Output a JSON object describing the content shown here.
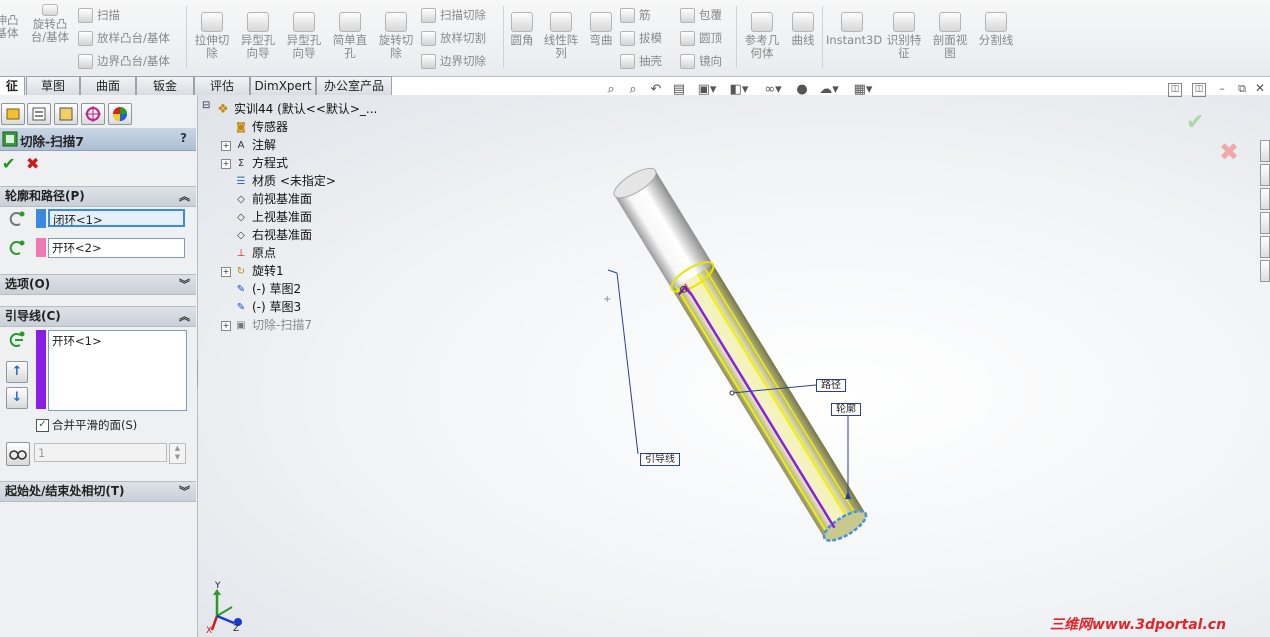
{
  "ribbon": {
    "features": [
      {
        "label_l1": "伸凸",
        "label_l2": "基体"
      },
      {
        "label_l1": "旋转凸",
        "label_l2": "台/基体"
      }
    ],
    "sweep_boss": "扫描",
    "loft_boss": "放样凸台/基体",
    "boundary_boss": "边界凸台/基体",
    "cut_extrude": {
      "l1": "拉伸切",
      "l2": "除"
    },
    "hole_wizard": {
      "l1": "异型孔",
      "l2": "向导"
    },
    "hole_wizard2": {
      "l1": "异型孔",
      "l2": "向导"
    },
    "simple_hole": {
      "l1": "简单直",
      "l2": "孔"
    },
    "revolve_cut": {
      "l1": "旋转切",
      "l2": "除"
    },
    "sweep_cut": "扫描切除",
    "loft_cut": "放样切割",
    "boundary_cut": "边界切除",
    "fillet": "圆角",
    "linear_pattern": {
      "l1": "线性阵",
      "l2": "列"
    },
    "flex": "弯曲",
    "rib": "筋",
    "draft": "拔模",
    "shell": "抽壳",
    "wrap": "包覆",
    "dome": "圆顶",
    "mirror": "镜向",
    "ref_geometry": {
      "l1": "参考几",
      "l2": "何体"
    },
    "curves": "曲线",
    "instant3d": "Instant3D",
    "recognize": {
      "l1": "识别特",
      "l2": "征"
    },
    "section_view": {
      "l1": "剖面视",
      "l2": "图"
    },
    "split_line": "分割线"
  },
  "tabs": [
    "征",
    "草图",
    "曲面",
    "钣金",
    "评估",
    "DimXpert",
    "办公室产品"
  ],
  "property_manager": {
    "title": "切除-扫描7",
    "help": "?",
    "ok": "✔",
    "cancel": "✖",
    "section_profile_path": {
      "title": "轮廓和路径(P)",
      "profile": "闭环<1>",
      "path": "开环<2>"
    },
    "section_options": {
      "title": "选项(O)"
    },
    "section_guides": {
      "title": "引导线(C)",
      "item": "开环<1>",
      "merge_label": "合并平滑的面(S)",
      "spinner_value": "1"
    },
    "section_tangency": {
      "title": "起始处/结束处相切(T)"
    }
  },
  "feature_tree": {
    "root": "实训44  (默认<<默认>_...",
    "items": [
      {
        "label": "传感器",
        "icon": "sensor-icon",
        "expand": false
      },
      {
        "label": "注解",
        "icon": "annotation-icon",
        "expand": true
      },
      {
        "label": "方程式",
        "icon": "equation-icon",
        "expand": true
      },
      {
        "label": "材质 <未指定>",
        "icon": "material-icon",
        "expand": false
      },
      {
        "label": "前视基准面",
        "icon": "plane-icon",
        "expand": false
      },
      {
        "label": "上视基准面",
        "icon": "plane-icon",
        "expand": false
      },
      {
        "label": "右视基准面",
        "icon": "plane-icon",
        "expand": false
      },
      {
        "label": "原点",
        "icon": "origin-icon",
        "expand": false
      },
      {
        "label": "旋转1",
        "icon": "revolve-icon",
        "expand": true
      },
      {
        "label": "(-) 草图2",
        "icon": "sketch-icon",
        "expand": false
      },
      {
        "label": "(-) 草图3",
        "icon": "sketch-icon",
        "expand": false
      },
      {
        "label": "切除-扫描7",
        "icon": "cut-sweep-icon",
        "expand": true
      }
    ]
  },
  "viewport": {
    "callout_path": "路径",
    "callout_profile": "轮廓",
    "callout_guide": "引导线",
    "triad_y": "Y",
    "triad_x": "X",
    "triad_z": "Z",
    "watermark": "三维网www.3dportal.cn"
  },
  "colors": {
    "accent": "#1e64c8",
    "profile_swatch": "#3a8be0",
    "path_swatch": "#f07ab4",
    "guide_swatch": "#8a1ee6",
    "ok": "#1a9a1a",
    "cancel": "#cc1a1a"
  }
}
